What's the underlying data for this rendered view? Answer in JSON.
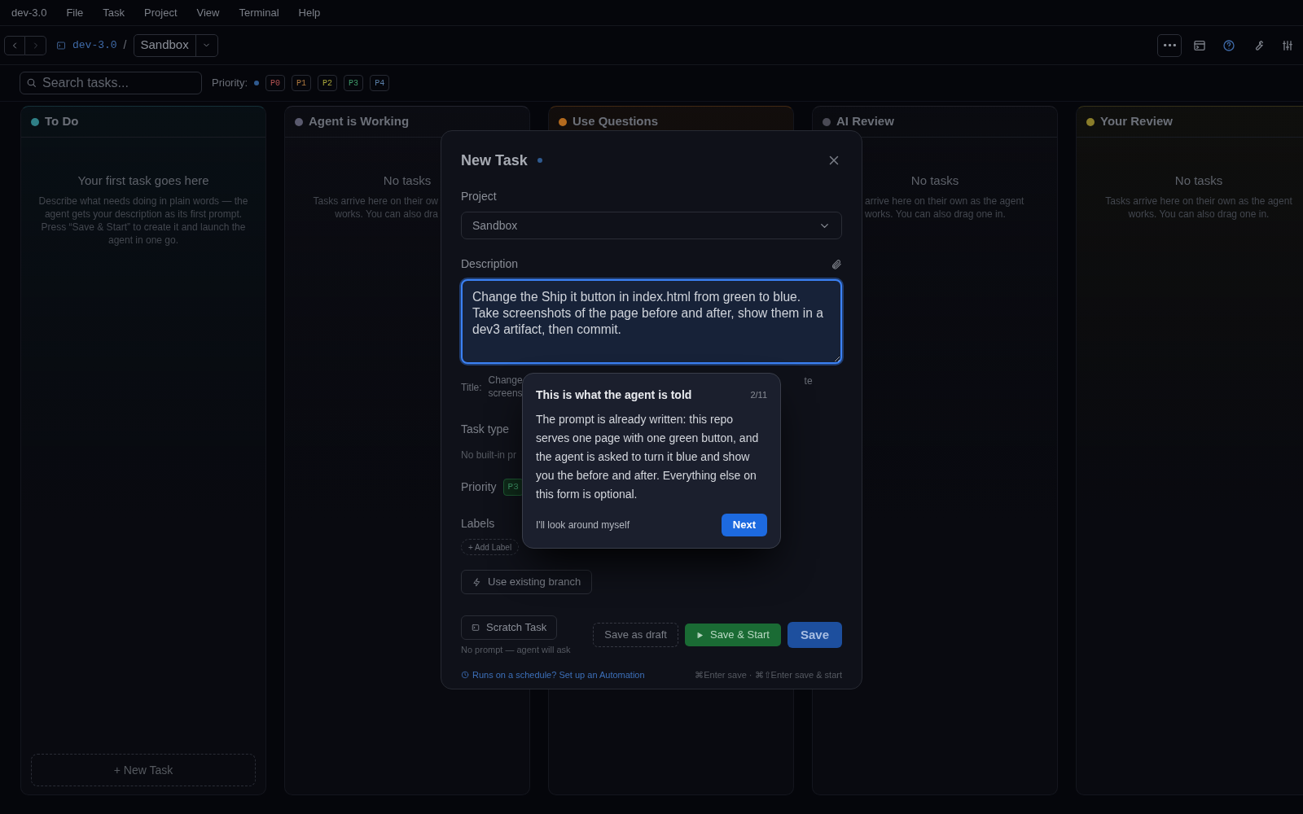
{
  "menu_bar": {
    "app": "dev-3.0",
    "items": [
      "File",
      "Task",
      "Project",
      "View",
      "Terminal",
      "Help"
    ]
  },
  "toolbar": {
    "path": "dev-3.0",
    "separator": "/",
    "project": "Sandbox"
  },
  "filter_bar": {
    "search": {
      "placeholder": "Search tasks..."
    },
    "priority_label": "Priority:",
    "chips": [
      {
        "label": "P0",
        "color": "#b45353",
        "selected": false
      },
      {
        "label": "P1",
        "color": "#b07a3f",
        "selected": false
      },
      {
        "label": "P2",
        "color": "#a8a53a",
        "selected": false
      },
      {
        "label": "P3",
        "color": "#3f9a6a",
        "selected": false
      },
      {
        "label": "P4",
        "color": "#5a7fa8",
        "selected": false
      }
    ]
  },
  "columns": [
    {
      "kind": "full",
      "name": "To Do",
      "color": "#2f7f86",
      "empty_title": "Your first task goes here",
      "empty_text": "Describe what needs doing in plain words — the agent gets your description as its first prompt. Press “Save & Start” to create it and launch the agent in one go.",
      "new_task": "+ New Task"
    },
    {
      "kind": "covered_right",
      "name": "Agent is Working",
      "color": "#5a5a6e",
      "empty_title": "No tasks",
      "lines": [
        "Tasks arrive here on their ow",
        "works. You can also dra"
      ]
    },
    {
      "kind": "covered",
      "name": "Use Questions",
      "color": "#b36a1e"
    },
    {
      "kind": "covered_left",
      "name": "AI Review",
      "color": "#4a4a55",
      "empty_title": "No tasks",
      "lines": [
        "arrive here on their own as the agent",
        "works. You can also drag one in."
      ]
    },
    {
      "kind": "full",
      "name": "Your Review",
      "color": "#8a7d2a",
      "empty_title": "No tasks",
      "empty_text": "Tasks arrive here on their own as the agent works. You can also drag one in."
    }
  ],
  "dialog": {
    "title": "New Task",
    "project_label": "Project",
    "project": "Sandbox",
    "description_label": "Description",
    "description": "Change the Ship it button in index.html from green to blue.\nTake screenshots of the page before and after, show them in a dev3 artifact, then commit.",
    "title_label": "Title:",
    "title_lines": [
      "Change",
      "screens"
    ],
    "title_tail": "te",
    "task_type_label": "Task type",
    "task_type_hint": "No built-in pr",
    "priority_label": "Priority",
    "priority": "P3",
    "labels_label": "Labels",
    "add_label": "+ Add Label",
    "branch_button": "Use existing branch",
    "scratch_button": "Scratch Task",
    "scratch_hint": "No prompt — agent will ask",
    "draft_button": "Save as draft",
    "start_button": "Save & Start",
    "save_button": "Save",
    "automation_link": "Runs on a schedule? Set up an Automation",
    "shortcuts": "⌘Enter save · ⌘⇧Enter save & start"
  },
  "tour": {
    "title": "This is what the agent is told",
    "step": "2/11",
    "body": "The prompt is already written: this repo serves one page with one green button, and the agent is asked to turn it blue and show you the before and after. Everything else on this form is optional.",
    "skip": "I'll look around myself",
    "next": "Next"
  }
}
